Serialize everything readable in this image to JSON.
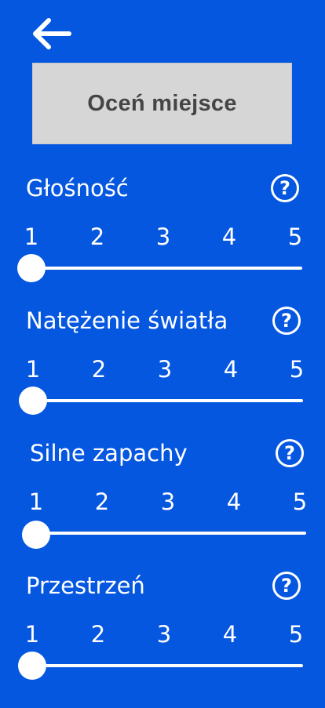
{
  "header": {
    "back_icon": "arrow-left-icon",
    "title": "Oceń miejsce"
  },
  "ratings": [
    {
      "label": "Głośność",
      "help": "?",
      "ticks": [
        "1",
        "2",
        "3",
        "4",
        "5"
      ],
      "value": 1
    },
    {
      "label": "Natężenie światła",
      "help": "?",
      "ticks": [
        "1",
        "2",
        "3",
        "4",
        "5"
      ],
      "value": 1
    },
    {
      "label": "Silne zapachy",
      "help": "?",
      "ticks": [
        "1",
        "2",
        "3",
        "4",
        "5"
      ],
      "value": 1
    },
    {
      "label": "Przestrzeń",
      "help": "?",
      "ticks": [
        "1",
        "2",
        "3",
        "4",
        "5"
      ],
      "value": 1
    }
  ],
  "colors": {
    "background": "#0557e0",
    "title_box": "#d6d6d6",
    "title_text": "#454545",
    "foreground": "#ffffff"
  }
}
